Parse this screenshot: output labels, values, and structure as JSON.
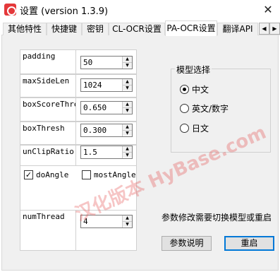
{
  "window": {
    "title": "设置 (version 1.3.9)",
    "close_glyph": "✕",
    "app_icon": "app-logo-icon"
  },
  "tabs": [
    {
      "label": "其他特性",
      "active": false
    },
    {
      "label": "快捷键",
      "active": false
    },
    {
      "label": "密钥",
      "active": false
    },
    {
      "label": "CL-OCR设置",
      "active": false
    },
    {
      "label": "PA-OCR设置",
      "active": true
    },
    {
      "label": "翻译API",
      "active": false
    }
  ],
  "tab_scroll": {
    "left": "◀",
    "right": "▶"
  },
  "params": [
    {
      "label": "padding",
      "value": "50"
    },
    {
      "label": "maxSideLen",
      "value": "1024"
    },
    {
      "label": "boxScoreThresh",
      "value": "0.650"
    },
    {
      "label": "boxThresh",
      "value": "0.300"
    },
    {
      "label": "unClipRatio",
      "value": "1.5"
    },
    {
      "label": "numThread",
      "value": "4"
    }
  ],
  "spin_arrows": {
    "up": "▲",
    "down": "▼"
  },
  "checkboxes": {
    "do_angle": {
      "label": "doAngle",
      "checked": true,
      "mark": "✓"
    },
    "most_angle": {
      "label": "mostAngle",
      "checked": false,
      "mark": ""
    }
  },
  "model_group": {
    "title": "模型选择",
    "options": [
      {
        "label": "中文",
        "selected": true
      },
      {
        "label": "英文/数字",
        "selected": false
      },
      {
        "label": "日文",
        "selected": false
      }
    ]
  },
  "note": "参数修改需要切换模型或重启",
  "buttons": {
    "help": "参数说明",
    "restart": "重启"
  },
  "watermark": "汉化版本 HyBase.com"
}
